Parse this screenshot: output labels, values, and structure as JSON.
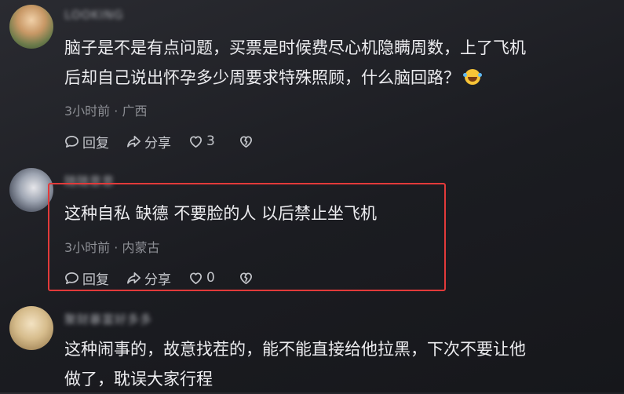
{
  "comments": [
    {
      "username": "LOOKING",
      "text_lines": [
        "脑子是不是有点问题，买票是时候费尽心机隐瞒周数，上了飞机",
        "后却自己说出怀孕多少周要求特殊照顾，什么脑回路？"
      ],
      "emoji": "rolling-laughing-emoji",
      "time": "3小时前",
      "location": "广西",
      "reply_label": "回复",
      "share_label": "分享",
      "like_count": "3"
    },
    {
      "username": "随随意意",
      "text_lines": [
        "这种自私 缺德 不要脸的人 以后禁止坐飞机"
      ],
      "time": "3小时前",
      "location": "内蒙古",
      "reply_label": "回复",
      "share_label": "分享",
      "like_count": "0",
      "highlighted": true
    },
    {
      "username": "聚财暴富好多多",
      "text_lines": [
        "这种闹事的，故意找茬的，能不能直接给他拉黑，下次不要让他",
        "做了，耽误大家行程"
      ]
    }
  ],
  "meta_separator": " · ",
  "colors": {
    "background": "#1b1c21",
    "text": "#ececef",
    "meta": "#8c8e94",
    "highlight": "#e23a3a"
  },
  "icons": [
    "comment-bubble-icon",
    "share-arrow-icon",
    "heart-icon",
    "broken-heart-icon"
  ]
}
